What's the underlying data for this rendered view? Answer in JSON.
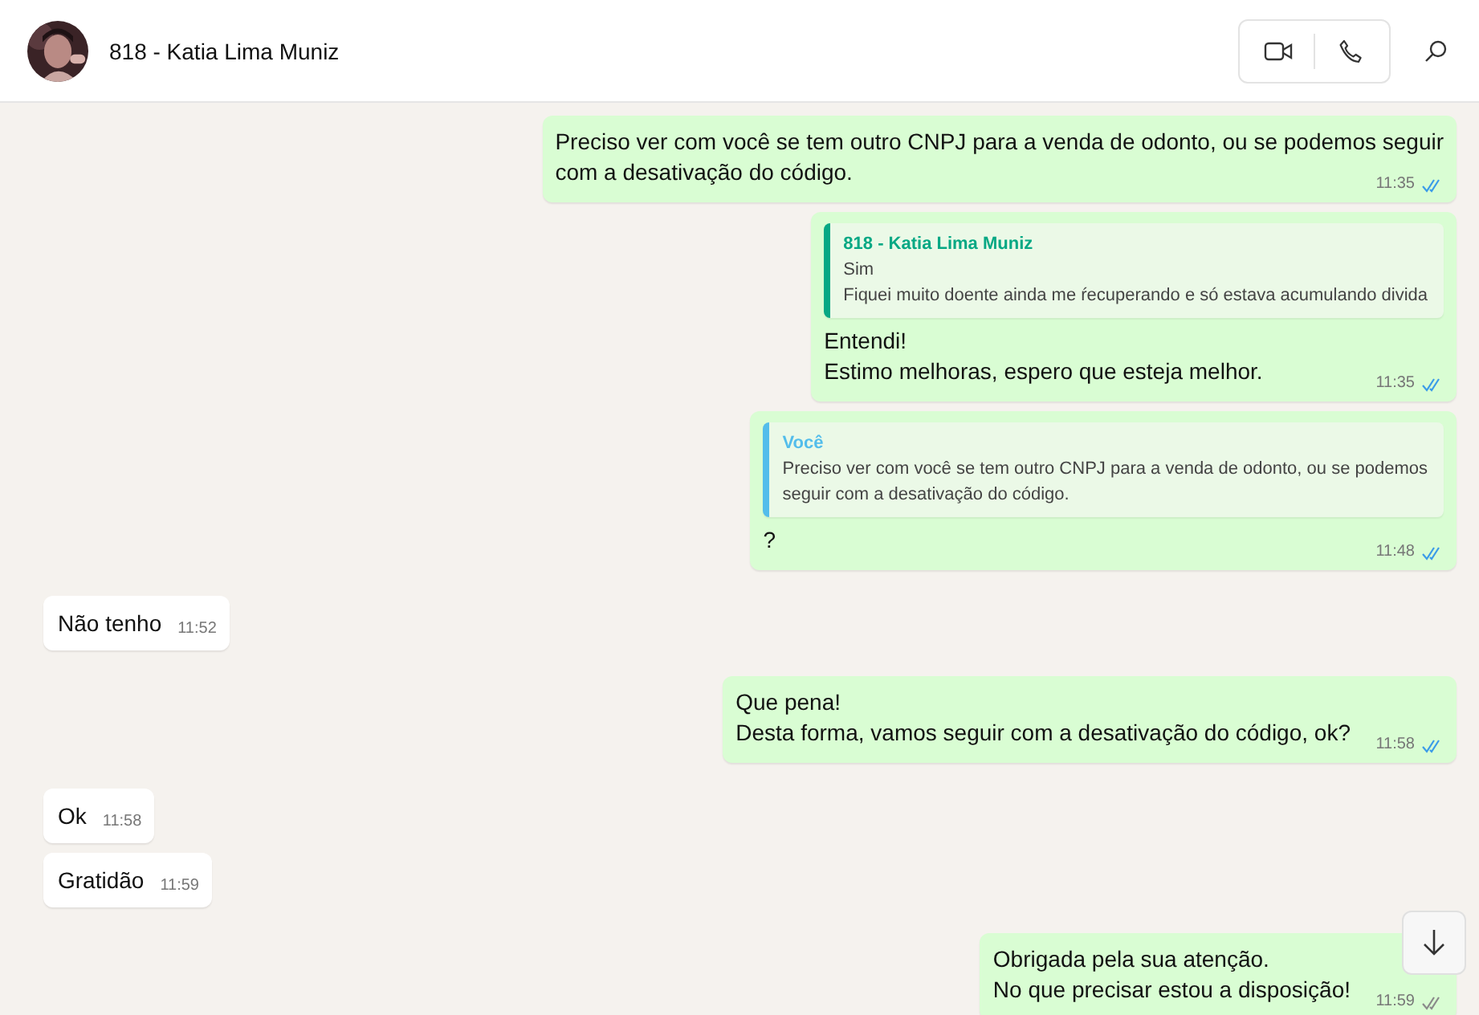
{
  "header": {
    "contact_name": "818 - Katia Lima Muniz"
  },
  "messages": [
    {
      "kind": "sent",
      "lines": [
        "Preciso ver com você se tem outro CNPJ para a venda de odonto, ou se podemos seguir",
        "com a desativação do código."
      ],
      "time": "11:35",
      "read": true
    },
    {
      "kind": "sent",
      "quote": {
        "author": "818 - Katia Lima Muniz",
        "kind": "contact",
        "lines": [
          "Sim",
          "Fiquei muito doente ainda me ŕecuperando e só estava acumulando divida"
        ]
      },
      "lines": [
        "Entendi!",
        "Estimo melhoras, espero que esteja melhor."
      ],
      "time": "11:35",
      "read": true
    },
    {
      "kind": "sent",
      "quote": {
        "author": "Você",
        "kind": "self",
        "lines": [
          "Preciso ver com você se tem outro CNPJ para a venda de odonto, ou se podemos",
          "seguir com a desativação do código."
        ]
      },
      "lines": [
        "?"
      ],
      "time": "11:48",
      "read": true
    },
    {
      "kind": "received",
      "lines": [
        "Não tenho"
      ],
      "time": "11:52"
    },
    {
      "kind": "sent",
      "lines": [
        "Que pena!",
        "Desta forma, vamos seguir com a desativação do código, ok?"
      ],
      "time": "11:58",
      "read": true
    },
    {
      "kind": "received",
      "lines": [
        "Ok"
      ],
      "time": "11:58"
    },
    {
      "kind": "received",
      "lines": [
        "Gratidão"
      ],
      "time": "11:59"
    },
    {
      "kind": "sent",
      "lines": [
        "Obrigada pela sua atenção.",
        "No que precisar estou a disposição!"
      ],
      "time": "11:59",
      "read": false
    }
  ]
}
